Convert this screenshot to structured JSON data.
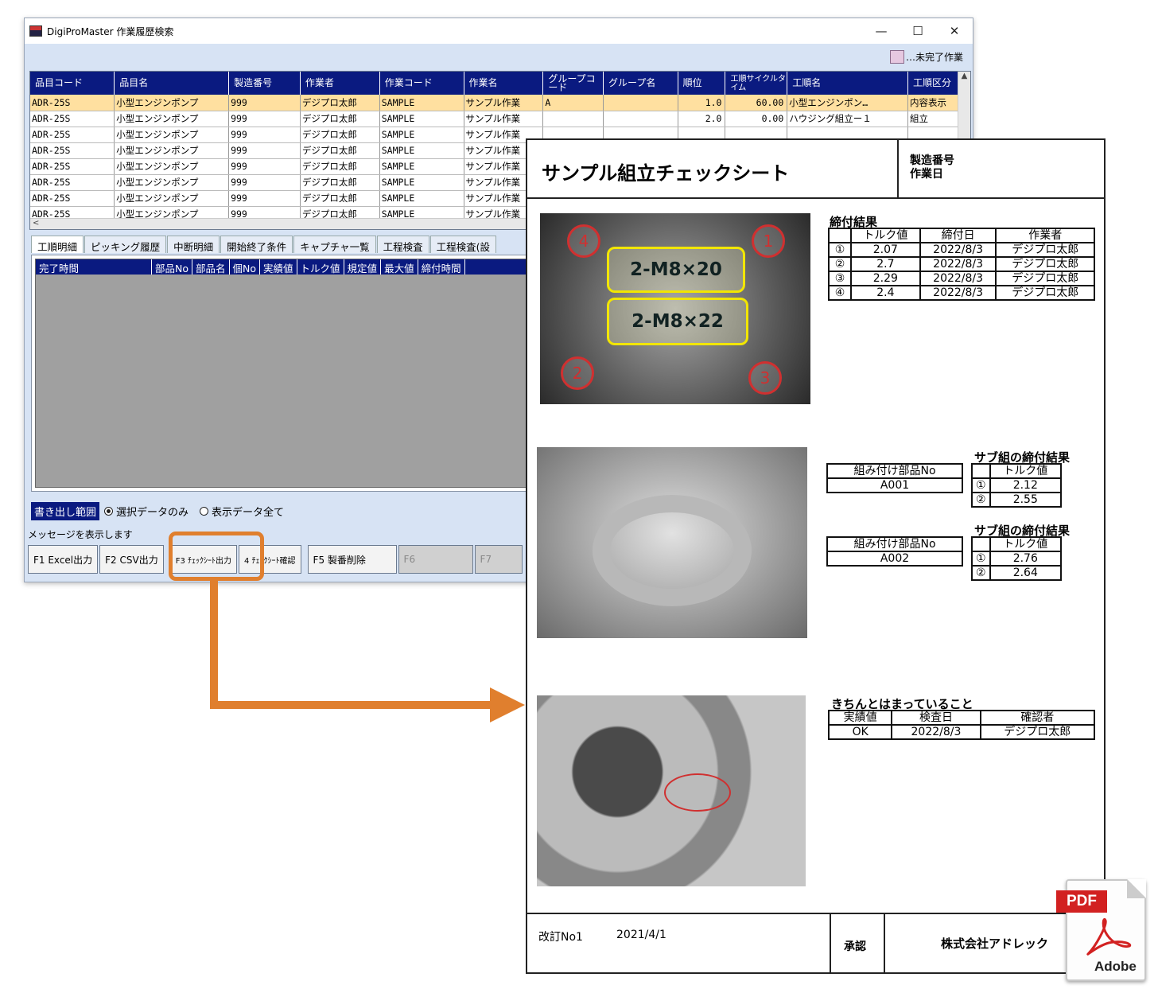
{
  "window": {
    "title": "DigiProMaster 作業履歴検索",
    "controls": {
      "minimize": "—",
      "maximize": "☐",
      "close": "✕"
    }
  },
  "legend": {
    "label": "…未完了作業",
    "color": "#e6c8e0"
  },
  "grid": {
    "headers": [
      "品目コード",
      "品目名",
      "製造番号",
      "作業者",
      "作業コード",
      "作業名",
      "グループコード",
      "グループ名",
      "順位",
      "工順サイクルタイム",
      "工順名",
      "工順区分"
    ],
    "rows": [
      [
        "ADR-25S",
        "小型エンジンポンプ",
        "999",
        "デジプロ太郎",
        "SAMPLE",
        "サンプル作業",
        "A",
        "",
        "1.0",
        "60.00",
        "小型エンジンポン…",
        "内容表示"
      ],
      [
        "ADR-25S",
        "小型エンジンポンプ",
        "999",
        "デジプロ太郎",
        "SAMPLE",
        "サンプル作業",
        "",
        "",
        "2.0",
        "0.00",
        "ハウジング組立ー１",
        "組立"
      ],
      [
        "ADR-25S",
        "小型エンジンポンプ",
        "999",
        "デジプロ太郎",
        "SAMPLE",
        "サンプル作業",
        "",
        "",
        "",
        "",
        "",
        ""
      ],
      [
        "ADR-25S",
        "小型エンジンポンプ",
        "999",
        "デジプロ太郎",
        "SAMPLE",
        "サンプル作業",
        "",
        "",
        "",
        "",
        "",
        ""
      ],
      [
        "ADR-25S",
        "小型エンジンポンプ",
        "999",
        "デジプロ太郎",
        "SAMPLE",
        "サンプル作業",
        "",
        "",
        "",
        "",
        "",
        ""
      ],
      [
        "ADR-25S",
        "小型エンジンポンプ",
        "999",
        "デジプロ太郎",
        "SAMPLE",
        "サンプル作業",
        "",
        "",
        "",
        "",
        "",
        ""
      ],
      [
        "ADR-25S",
        "小型エンジンポンプ",
        "999",
        "デジプロ太郎",
        "SAMPLE",
        "サンプル作業",
        "",
        "",
        "",
        "",
        "",
        ""
      ],
      [
        "ADR-25S",
        "小型エンジンポンプ",
        "999",
        "デジプロ太郎",
        "SAMPLE",
        "サンプル作業",
        "",
        "",
        "",
        "",
        "",
        ""
      ]
    ],
    "hscroll_arrow": "<"
  },
  "tabs": [
    "工順明細",
    "ピッキング履歴",
    "中断明細",
    "開始終了条件",
    "キャプチャ一覧",
    "工程検査",
    "工程検査(設"
  ],
  "detail_headers": [
    "完了時間",
    "部品No",
    "部品名",
    "個No",
    "実績値",
    "トルク値",
    "規定値",
    "最大値",
    "締付時間"
  ],
  "export": {
    "label": "書き出し範囲",
    "option_selected": "選択データのみ",
    "option_all": "表示データ全て"
  },
  "message": "メッセージを表示します",
  "fkeys": {
    "f1": "F1 Excel出力",
    "f2": "F2 CSV出力",
    "f3": "F3 ﾁｪｯｸｼｰﾄ出力",
    "f4": "4 ﾁｪｯｸｼｰﾄ確認",
    "f5": "F5 製番削除",
    "f6": "F6",
    "f7": "F7"
  },
  "sheet": {
    "title": "サンプル組立チェックシート",
    "meta_line1": "製造番号",
    "meta_line2": "作業日",
    "photo1_markers": [
      "4",
      "1",
      "2",
      "3"
    ],
    "photo1_labels": [
      "2-M8×20",
      "2-M8×22"
    ],
    "section1": {
      "title": "締付結果",
      "headers": [
        "",
        "トルク値",
        "締付日",
        "作業者"
      ],
      "rows": [
        [
          "①",
          "2.07",
          "2022/8/3",
          "デジプロ太郎"
        ],
        [
          "②",
          "2.7",
          "2022/8/3",
          "デジプロ太郎"
        ],
        [
          "③",
          "2.29",
          "2022/8/3",
          "デジプロ太郎"
        ],
        [
          "④",
          "2.4",
          "2022/8/3",
          "デジプロ太郎"
        ]
      ]
    },
    "section2": {
      "part_header": "組み付け部品No",
      "sub_title": "サブ組の締付結果",
      "sub_header": "トルク値",
      "blocks": [
        {
          "part": "A001",
          "rows": [
            [
              "①",
              "2.12"
            ],
            [
              "②",
              "2.55"
            ]
          ]
        },
        {
          "part": "A002",
          "rows": [
            [
              "①",
              "2.76"
            ],
            [
              "②",
              "2.64"
            ]
          ]
        }
      ]
    },
    "section3": {
      "title": "きちんとはまっていること",
      "headers": [
        "実績値",
        "検査日",
        "確認者"
      ],
      "row": [
        "OK",
        "2022/8/3",
        "デジプロ太郎"
      ]
    },
    "footer": {
      "revision": "改訂No1",
      "date": "2021/4/1",
      "approve": "承認",
      "company": "株式会社アドレック"
    }
  },
  "pdf_icon": {
    "badge": "PDF",
    "brand": "Adobe"
  },
  "colors": {
    "accent_orange": "#e07f2e",
    "grid_header": "#0a1a80",
    "selected_row": "#ffe0a0",
    "marker_red": "#d03030"
  }
}
